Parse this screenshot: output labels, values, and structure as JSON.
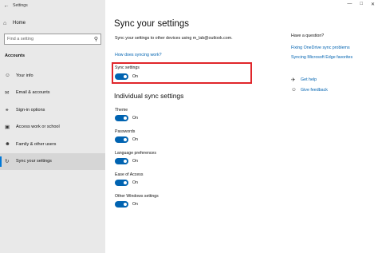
{
  "window": {
    "title": "Settings"
  },
  "sidebar": {
    "home_label": "Home",
    "search_placeholder": "Find a setting",
    "section_label": "Accounts",
    "items": [
      {
        "label": "Your info",
        "icon": "person-icon"
      },
      {
        "label": "Email & accounts",
        "icon": "mail-icon"
      },
      {
        "label": "Sign-in options",
        "icon": "key-icon"
      },
      {
        "label": "Access work or school",
        "icon": "briefcase-icon"
      },
      {
        "label": "Family & other users",
        "icon": "people-icon"
      },
      {
        "label": "Sync your settings",
        "icon": "sync-icon"
      }
    ]
  },
  "main": {
    "title": "Sync your settings",
    "description": "Sync your settings to other devices using m_lab@outlook.com.",
    "how_link": "How does syncing work?",
    "sync_settings_label": "Sync settings",
    "sync_settings_state": "On",
    "individual_heading": "Individual sync settings",
    "settings": [
      {
        "label": "Theme",
        "state": "On"
      },
      {
        "label": "Passwords",
        "state": "On"
      },
      {
        "label": "Language preferences",
        "state": "On"
      },
      {
        "label": "Ease of Access",
        "state": "On"
      },
      {
        "label": "Other Windows settings",
        "state": "On"
      }
    ]
  },
  "right": {
    "question": "Have a question?",
    "link1": "Fixing OneDrive sync problems",
    "link2": "Syncing Microsoft Edge favorites",
    "help": "Get help",
    "feedback": "Give feedback"
  },
  "colors": {
    "accent": "#0063b1",
    "highlight_box": "#e0262b",
    "sidebar_bg": "#e9e9e9"
  }
}
